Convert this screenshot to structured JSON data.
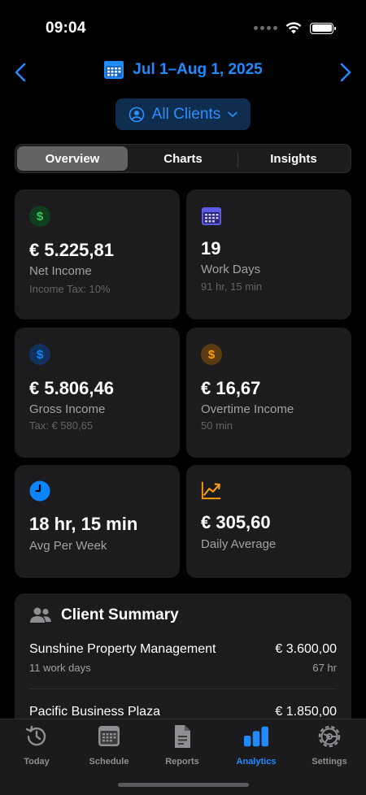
{
  "status": {
    "time": "09:04"
  },
  "date_nav": {
    "range": "Jul 1–Aug 1, 2025"
  },
  "client_picker": {
    "label": "All Clients"
  },
  "segments": [
    "Overview",
    "Charts",
    "Insights"
  ],
  "cards": {
    "net_income": {
      "value": "€ 5.225,81",
      "label": "Net Income",
      "sub": "Income Tax: 10%"
    },
    "work_days": {
      "value": "19",
      "label": "Work Days",
      "sub": "91 hr, 15 min"
    },
    "gross_income": {
      "value": "€ 5.806,46",
      "label": "Gross Income",
      "sub": "Tax: € 580,65"
    },
    "overtime_income": {
      "value": "€ 16,67",
      "label": "Overtime Income",
      "sub": "50 min"
    },
    "avg_per_week": {
      "value": "18 hr, 15 min",
      "label": "Avg Per Week"
    },
    "daily_average": {
      "value": "€ 305,60",
      "label": "Daily Average"
    }
  },
  "summary": {
    "title": "Client Summary",
    "clients": [
      {
        "name": "Sunshine Property Management",
        "amount": "€ 3.600,00",
        "days": "11 work days",
        "hours": "67 hr"
      },
      {
        "name": "Pacific Business Plaza",
        "amount": "€ 1.850,00"
      }
    ]
  },
  "tabs": [
    {
      "label": "Today",
      "icon": "clock-history-icon"
    },
    {
      "label": "Schedule",
      "icon": "calendar-grid-icon"
    },
    {
      "label": "Reports",
      "icon": "document-icon"
    },
    {
      "label": "Analytics",
      "icon": "bar-chart-icon",
      "active": true
    },
    {
      "label": "Settings",
      "icon": "gear-icon"
    }
  ],
  "colors": {
    "accent": "#1f8bff",
    "green": "#34c759",
    "purple": "#5e5ce6",
    "orange": "#ff9f0a",
    "blue": "#0a84ff"
  }
}
